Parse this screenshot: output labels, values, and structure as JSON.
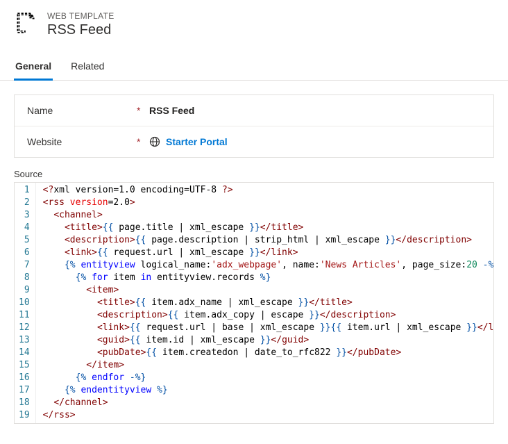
{
  "header": {
    "breadcrumb": "WEB TEMPLATE",
    "title": "RSS Feed"
  },
  "tabs": {
    "general": "General",
    "related": "Related"
  },
  "form": {
    "name_label": "Name",
    "name_value": "RSS Feed",
    "website_label": "Website",
    "website_value": "Starter Portal"
  },
  "source": {
    "label": "Source",
    "lines": [
      [
        {
          "c": "tk-br",
          "t": "<?"
        },
        {
          "t": "xml version=1.0 encoding=UTF-8 "
        },
        {
          "c": "tk-br",
          "t": "?>"
        }
      ],
      [
        {
          "c": "tk-br",
          "t": "<"
        },
        {
          "c": "tk-tag",
          "t": "rss"
        },
        {
          "t": " "
        },
        {
          "c": "tk-attr",
          "t": "version"
        },
        {
          "t": "="
        },
        {
          "t": "2.0"
        },
        {
          "c": "tk-br",
          "t": ">"
        }
      ],
      [
        {
          "t": "  "
        },
        {
          "c": "tk-br",
          "t": "<"
        },
        {
          "c": "tk-tag",
          "t": "channel"
        },
        {
          "c": "tk-br",
          "t": ">"
        }
      ],
      [
        {
          "t": "    "
        },
        {
          "c": "tk-br",
          "t": "<"
        },
        {
          "c": "tk-tag",
          "t": "title"
        },
        {
          "c": "tk-br",
          "t": ">"
        },
        {
          "c": "tk-dl",
          "t": "{{ "
        },
        {
          "t": "page.title | xml_escape "
        },
        {
          "c": "tk-dl",
          "t": "}}"
        },
        {
          "c": "tk-br",
          "t": "</"
        },
        {
          "c": "tk-tag",
          "t": "title"
        },
        {
          "c": "tk-br",
          "t": ">"
        }
      ],
      [
        {
          "t": "    "
        },
        {
          "c": "tk-br",
          "t": "<"
        },
        {
          "c": "tk-tag",
          "t": "description"
        },
        {
          "c": "tk-br",
          "t": ">"
        },
        {
          "c": "tk-dl",
          "t": "{{ "
        },
        {
          "t": "page.description | strip_html | xml_escape "
        },
        {
          "c": "tk-dl",
          "t": "}}"
        },
        {
          "c": "tk-br",
          "t": "</"
        },
        {
          "c": "tk-tag",
          "t": "description"
        },
        {
          "c": "tk-br",
          "t": ">"
        }
      ],
      [
        {
          "t": "    "
        },
        {
          "c": "tk-br",
          "t": "<"
        },
        {
          "c": "tk-tag",
          "t": "link"
        },
        {
          "c": "tk-br",
          "t": ">"
        },
        {
          "c": "tk-dl",
          "t": "{{ "
        },
        {
          "t": "request.url | xml_escape "
        },
        {
          "c": "tk-dl",
          "t": "}}"
        },
        {
          "c": "tk-br",
          "t": "</"
        },
        {
          "c": "tk-tag",
          "t": "link"
        },
        {
          "c": "tk-br",
          "t": ">"
        }
      ],
      [
        {
          "t": "    "
        },
        {
          "c": "tk-dl",
          "t": "{% "
        },
        {
          "c": "tk-kw",
          "t": "entityview"
        },
        {
          "t": " logical_name:"
        },
        {
          "c": "tk-str",
          "t": "'adx_webpage'"
        },
        {
          "t": ", name:"
        },
        {
          "c": "tk-str",
          "t": "'News Articles'"
        },
        {
          "t": ", page_size:"
        },
        {
          "c": "tk-num",
          "t": "20"
        },
        {
          "t": " "
        },
        {
          "c": "tk-dl",
          "t": "-%}"
        }
      ],
      [
        {
          "t": "      "
        },
        {
          "c": "tk-dl",
          "t": "{% "
        },
        {
          "c": "tk-kw",
          "t": "for"
        },
        {
          "t": " item "
        },
        {
          "c": "tk-kw",
          "t": "in"
        },
        {
          "t": " entityview.records "
        },
        {
          "c": "tk-dl",
          "t": "%}"
        }
      ],
      [
        {
          "t": "        "
        },
        {
          "c": "tk-br",
          "t": "<"
        },
        {
          "c": "tk-tag",
          "t": "item"
        },
        {
          "c": "tk-br",
          "t": ">"
        }
      ],
      [
        {
          "t": "          "
        },
        {
          "c": "tk-br",
          "t": "<"
        },
        {
          "c": "tk-tag",
          "t": "title"
        },
        {
          "c": "tk-br",
          "t": ">"
        },
        {
          "c": "tk-dl",
          "t": "{{ "
        },
        {
          "t": "item.adx_name | xml_escape "
        },
        {
          "c": "tk-dl",
          "t": "}}"
        },
        {
          "c": "tk-br",
          "t": "</"
        },
        {
          "c": "tk-tag",
          "t": "title"
        },
        {
          "c": "tk-br",
          "t": ">"
        }
      ],
      [
        {
          "t": "          "
        },
        {
          "c": "tk-br",
          "t": "<"
        },
        {
          "c": "tk-tag",
          "t": "description"
        },
        {
          "c": "tk-br",
          "t": ">"
        },
        {
          "c": "tk-dl",
          "t": "{{ "
        },
        {
          "t": "item.adx_copy | escape "
        },
        {
          "c": "tk-dl",
          "t": "}}"
        },
        {
          "c": "tk-br",
          "t": "</"
        },
        {
          "c": "tk-tag",
          "t": "description"
        },
        {
          "c": "tk-br",
          "t": ">"
        }
      ],
      [
        {
          "t": "          "
        },
        {
          "c": "tk-br",
          "t": "<"
        },
        {
          "c": "tk-tag",
          "t": "link"
        },
        {
          "c": "tk-br",
          "t": ">"
        },
        {
          "c": "tk-dl",
          "t": "{{ "
        },
        {
          "t": "request.url | base | xml_escape "
        },
        {
          "c": "tk-dl",
          "t": "}}"
        },
        {
          "c": "tk-dl",
          "t": "{{ "
        },
        {
          "t": "item.url | xml_escape "
        },
        {
          "c": "tk-dl",
          "t": "}}"
        },
        {
          "c": "tk-br",
          "t": "</"
        },
        {
          "c": "tk-tag",
          "t": "link"
        },
        {
          "c": "tk-br",
          "t": ">"
        }
      ],
      [
        {
          "t": "          "
        },
        {
          "c": "tk-br",
          "t": "<"
        },
        {
          "c": "tk-tag",
          "t": "guid"
        },
        {
          "c": "tk-br",
          "t": ">"
        },
        {
          "c": "tk-dl",
          "t": "{{ "
        },
        {
          "t": "item.id | xml_escape "
        },
        {
          "c": "tk-dl",
          "t": "}}"
        },
        {
          "c": "tk-br",
          "t": "</"
        },
        {
          "c": "tk-tag",
          "t": "guid"
        },
        {
          "c": "tk-br",
          "t": ">"
        }
      ],
      [
        {
          "t": "          "
        },
        {
          "c": "tk-br",
          "t": "<"
        },
        {
          "c": "tk-tag",
          "t": "pubDate"
        },
        {
          "c": "tk-br",
          "t": ">"
        },
        {
          "c": "tk-dl",
          "t": "{{ "
        },
        {
          "t": "item.createdon | date_to_rfc822 "
        },
        {
          "c": "tk-dl",
          "t": "}}"
        },
        {
          "c": "tk-br",
          "t": "</"
        },
        {
          "c": "tk-tag",
          "t": "pubDate"
        },
        {
          "c": "tk-br",
          "t": ">"
        }
      ],
      [
        {
          "t": "        "
        },
        {
          "c": "tk-br",
          "t": "</"
        },
        {
          "c": "tk-tag",
          "t": "item"
        },
        {
          "c": "tk-br",
          "t": ">"
        }
      ],
      [
        {
          "t": "      "
        },
        {
          "c": "tk-dl",
          "t": "{% "
        },
        {
          "c": "tk-kw",
          "t": "endfor"
        },
        {
          "t": " "
        },
        {
          "c": "tk-dl",
          "t": "-%}"
        }
      ],
      [
        {
          "t": "    "
        },
        {
          "c": "tk-dl",
          "t": "{% "
        },
        {
          "c": "tk-kw",
          "t": "endentityview"
        },
        {
          "t": " "
        },
        {
          "c": "tk-dl",
          "t": "%}"
        }
      ],
      [
        {
          "t": "  "
        },
        {
          "c": "tk-br",
          "t": "</"
        },
        {
          "c": "tk-tag",
          "t": "channel"
        },
        {
          "c": "tk-br",
          "t": ">"
        }
      ],
      [
        {
          "c": "tk-br",
          "t": "</"
        },
        {
          "c": "tk-tag",
          "t": "rss"
        },
        {
          "c": "tk-br",
          "t": ">"
        }
      ]
    ]
  }
}
